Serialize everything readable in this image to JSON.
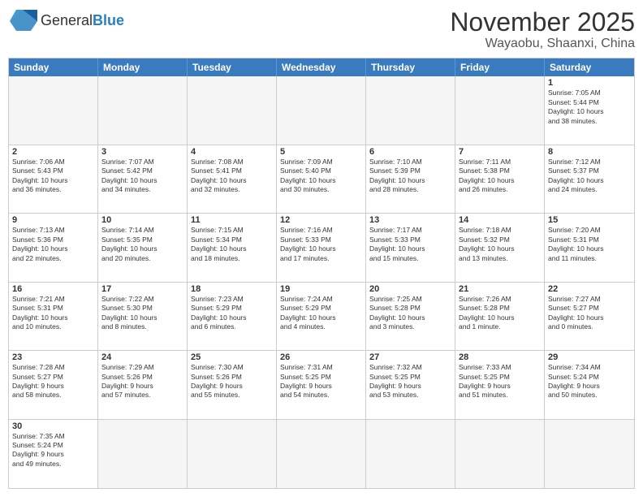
{
  "header": {
    "logo_general": "General",
    "logo_blue": "Blue",
    "month": "November 2025",
    "location": "Wayaobu, Shaanxi, China"
  },
  "days_of_week": [
    "Sunday",
    "Monday",
    "Tuesday",
    "Wednesday",
    "Thursday",
    "Friday",
    "Saturday"
  ],
  "weeks": [
    [
      {
        "day": "",
        "info": ""
      },
      {
        "day": "",
        "info": ""
      },
      {
        "day": "",
        "info": ""
      },
      {
        "day": "",
        "info": ""
      },
      {
        "day": "",
        "info": ""
      },
      {
        "day": "",
        "info": ""
      },
      {
        "day": "1",
        "info": "Sunrise: 7:05 AM\nSunset: 5:44 PM\nDaylight: 10 hours\nand 38 minutes."
      }
    ],
    [
      {
        "day": "2",
        "info": "Sunrise: 7:06 AM\nSunset: 5:43 PM\nDaylight: 10 hours\nand 36 minutes."
      },
      {
        "day": "3",
        "info": "Sunrise: 7:07 AM\nSunset: 5:42 PM\nDaylight: 10 hours\nand 34 minutes."
      },
      {
        "day": "4",
        "info": "Sunrise: 7:08 AM\nSunset: 5:41 PM\nDaylight: 10 hours\nand 32 minutes."
      },
      {
        "day": "5",
        "info": "Sunrise: 7:09 AM\nSunset: 5:40 PM\nDaylight: 10 hours\nand 30 minutes."
      },
      {
        "day": "6",
        "info": "Sunrise: 7:10 AM\nSunset: 5:39 PM\nDaylight: 10 hours\nand 28 minutes."
      },
      {
        "day": "7",
        "info": "Sunrise: 7:11 AM\nSunset: 5:38 PM\nDaylight: 10 hours\nand 26 minutes."
      },
      {
        "day": "8",
        "info": "Sunrise: 7:12 AM\nSunset: 5:37 PM\nDaylight: 10 hours\nand 24 minutes."
      }
    ],
    [
      {
        "day": "9",
        "info": "Sunrise: 7:13 AM\nSunset: 5:36 PM\nDaylight: 10 hours\nand 22 minutes."
      },
      {
        "day": "10",
        "info": "Sunrise: 7:14 AM\nSunset: 5:35 PM\nDaylight: 10 hours\nand 20 minutes."
      },
      {
        "day": "11",
        "info": "Sunrise: 7:15 AM\nSunset: 5:34 PM\nDaylight: 10 hours\nand 18 minutes."
      },
      {
        "day": "12",
        "info": "Sunrise: 7:16 AM\nSunset: 5:33 PM\nDaylight: 10 hours\nand 17 minutes."
      },
      {
        "day": "13",
        "info": "Sunrise: 7:17 AM\nSunset: 5:33 PM\nDaylight: 10 hours\nand 15 minutes."
      },
      {
        "day": "14",
        "info": "Sunrise: 7:18 AM\nSunset: 5:32 PM\nDaylight: 10 hours\nand 13 minutes."
      },
      {
        "day": "15",
        "info": "Sunrise: 7:20 AM\nSunset: 5:31 PM\nDaylight: 10 hours\nand 11 minutes."
      }
    ],
    [
      {
        "day": "16",
        "info": "Sunrise: 7:21 AM\nSunset: 5:31 PM\nDaylight: 10 hours\nand 10 minutes."
      },
      {
        "day": "17",
        "info": "Sunrise: 7:22 AM\nSunset: 5:30 PM\nDaylight: 10 hours\nand 8 minutes."
      },
      {
        "day": "18",
        "info": "Sunrise: 7:23 AM\nSunset: 5:29 PM\nDaylight: 10 hours\nand 6 minutes."
      },
      {
        "day": "19",
        "info": "Sunrise: 7:24 AM\nSunset: 5:29 PM\nDaylight: 10 hours\nand 4 minutes."
      },
      {
        "day": "20",
        "info": "Sunrise: 7:25 AM\nSunset: 5:28 PM\nDaylight: 10 hours\nand 3 minutes."
      },
      {
        "day": "21",
        "info": "Sunrise: 7:26 AM\nSunset: 5:28 PM\nDaylight: 10 hours\nand 1 minute."
      },
      {
        "day": "22",
        "info": "Sunrise: 7:27 AM\nSunset: 5:27 PM\nDaylight: 10 hours\nand 0 minutes."
      }
    ],
    [
      {
        "day": "23",
        "info": "Sunrise: 7:28 AM\nSunset: 5:27 PM\nDaylight: 9 hours\nand 58 minutes."
      },
      {
        "day": "24",
        "info": "Sunrise: 7:29 AM\nSunset: 5:26 PM\nDaylight: 9 hours\nand 57 minutes."
      },
      {
        "day": "25",
        "info": "Sunrise: 7:30 AM\nSunset: 5:26 PM\nDaylight: 9 hours\nand 55 minutes."
      },
      {
        "day": "26",
        "info": "Sunrise: 7:31 AM\nSunset: 5:25 PM\nDaylight: 9 hours\nand 54 minutes."
      },
      {
        "day": "27",
        "info": "Sunrise: 7:32 AM\nSunset: 5:25 PM\nDaylight: 9 hours\nand 53 minutes."
      },
      {
        "day": "28",
        "info": "Sunrise: 7:33 AM\nSunset: 5:25 PM\nDaylight: 9 hours\nand 51 minutes."
      },
      {
        "day": "29",
        "info": "Sunrise: 7:34 AM\nSunset: 5:24 PM\nDaylight: 9 hours\nand 50 minutes."
      }
    ],
    [
      {
        "day": "30",
        "info": "Sunrise: 7:35 AM\nSunset: 5:24 PM\nDaylight: 9 hours\nand 49 minutes."
      },
      {
        "day": "",
        "info": ""
      },
      {
        "day": "",
        "info": ""
      },
      {
        "day": "",
        "info": ""
      },
      {
        "day": "",
        "info": ""
      },
      {
        "day": "",
        "info": ""
      },
      {
        "day": "",
        "info": ""
      }
    ]
  ]
}
